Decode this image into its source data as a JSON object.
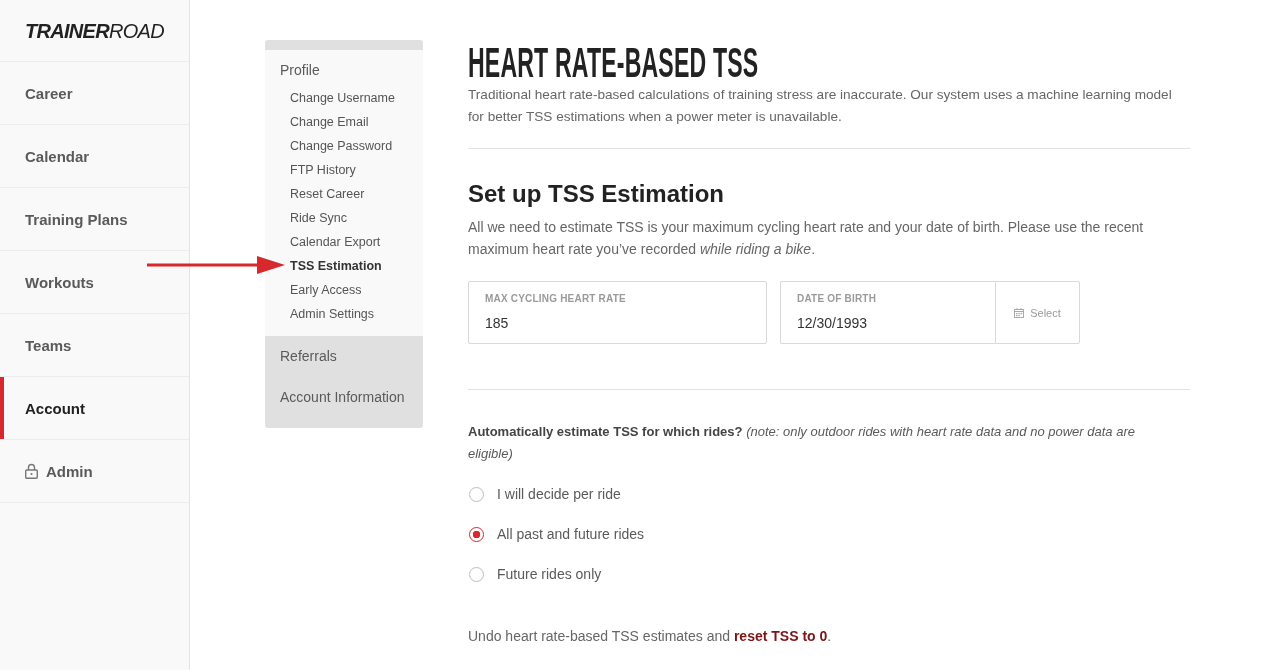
{
  "sidebar": {
    "logo": "**TRAINER**ROAD",
    "items": [
      {
        "label": "Career",
        "selected": false,
        "locked": false
      },
      {
        "label": "Calendar",
        "selected": false,
        "locked": false
      },
      {
        "label": "Training Plans",
        "selected": false,
        "locked": false
      },
      {
        "label": "Workouts",
        "selected": false,
        "locked": false
      },
      {
        "label": "Teams",
        "selected": false,
        "locked": false
      },
      {
        "label": "Account",
        "selected": true,
        "locked": false
      },
      {
        "label": "Admin",
        "selected": false,
        "locked": true
      }
    ]
  },
  "settings_menu": {
    "sections": [
      {
        "label": "Profile",
        "expanded": true,
        "children": [
          {
            "label": "Change Username",
            "selected": false
          },
          {
            "label": "Change Email",
            "selected": false
          },
          {
            "label": "Change Password",
            "selected": false
          },
          {
            "label": "FTP History",
            "selected": false
          },
          {
            "label": "Reset Career",
            "selected": false
          },
          {
            "label": "Ride Sync",
            "selected": false
          },
          {
            "label": "Calendar Export",
            "selected": false
          },
          {
            "label": "TSS Estimation",
            "selected": true
          },
          {
            "label": "Early Access",
            "selected": false
          },
          {
            "label": "Admin Settings",
            "selected": false
          }
        ]
      },
      {
        "label": "Referrals",
        "expanded": false
      },
      {
        "label": "Account Information",
        "expanded": false
      }
    ]
  },
  "main": {
    "title": "HEART RATE-BASED TSS",
    "description": "Traditional heart rate-based calculations of training stress are inaccurate. Our system uses a machine learning model for better TSS estimations when a power meter is unavailable.",
    "setup": {
      "heading": "Set up TSS Estimation",
      "text": "All we need to estimate TSS is your maximum cycling heart rate and your date of birth. Please use the recent maximum heart rate you’ve recorded *while riding a bike*.",
      "fields": [
        {
          "kind": "number",
          "label": "MAX CYCLING HEART RATE",
          "value": "185"
        },
        {
          "kind": "date",
          "label": "DATE OF BIRTH",
          "value": "12/30/1993",
          "button": "Select"
        }
      ]
    },
    "question": "**Automatically estimate TSS for which rides?** *(note: only outdoor rides with heart rate data and no power data are eligible)*",
    "options": [
      {
        "label": "I will decide per ride",
        "selected": false
      },
      {
        "label": "All past and future rides",
        "selected": true
      },
      {
        "label": "Future rides only",
        "selected": false
      }
    ],
    "reset": {
      "text": "Undo heart rate-based TSS estimates and",
      "link": "reset TSS to 0",
      "after": "."
    }
  }
}
